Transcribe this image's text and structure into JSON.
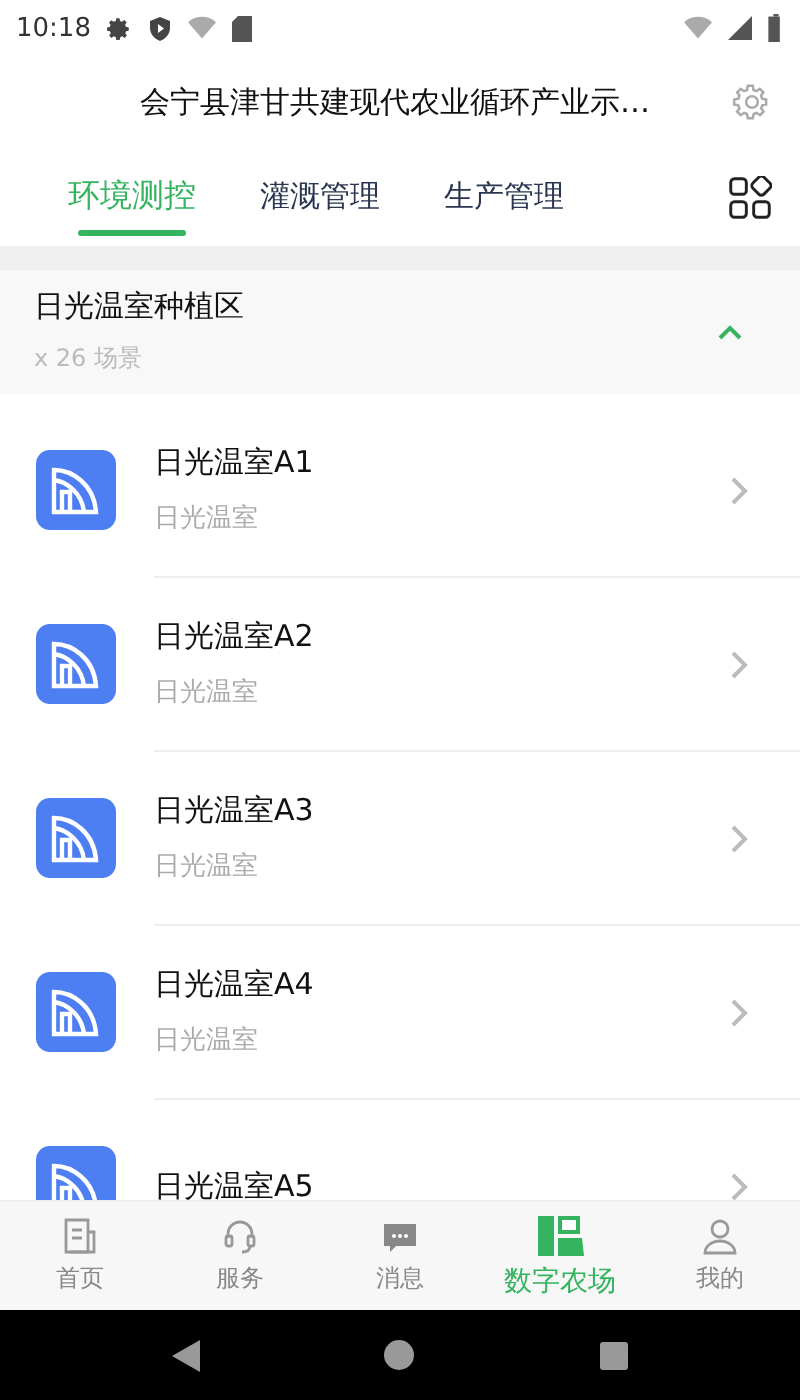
{
  "status_bar": {
    "time": "10:18"
  },
  "header": {
    "title": "会宁县津甘共建现代农业循环产业示…"
  },
  "tabs": [
    {
      "label": "环境测控",
      "selected": true
    },
    {
      "label": "灌溉管理",
      "selected": false
    },
    {
      "label": "生产管理",
      "selected": false
    }
  ],
  "group": {
    "title": "日光温室种植区",
    "count": "x 26 场景",
    "expanded": true
  },
  "items": [
    {
      "name": "日光温室A1",
      "type": "日光温室"
    },
    {
      "name": "日光温室A2",
      "type": "日光温室"
    },
    {
      "name": "日光温室A3",
      "type": "日光温室"
    },
    {
      "name": "日光温室A4",
      "type": "日光温室"
    },
    {
      "name": "日光温室A5"
    }
  ],
  "bottom_nav": [
    {
      "label": "首页",
      "selected": false
    },
    {
      "label": "服务",
      "selected": false
    },
    {
      "label": "消息",
      "selected": false
    },
    {
      "label": "数字农场",
      "selected": true
    },
    {
      "label": "我的",
      "selected": false
    }
  ]
}
